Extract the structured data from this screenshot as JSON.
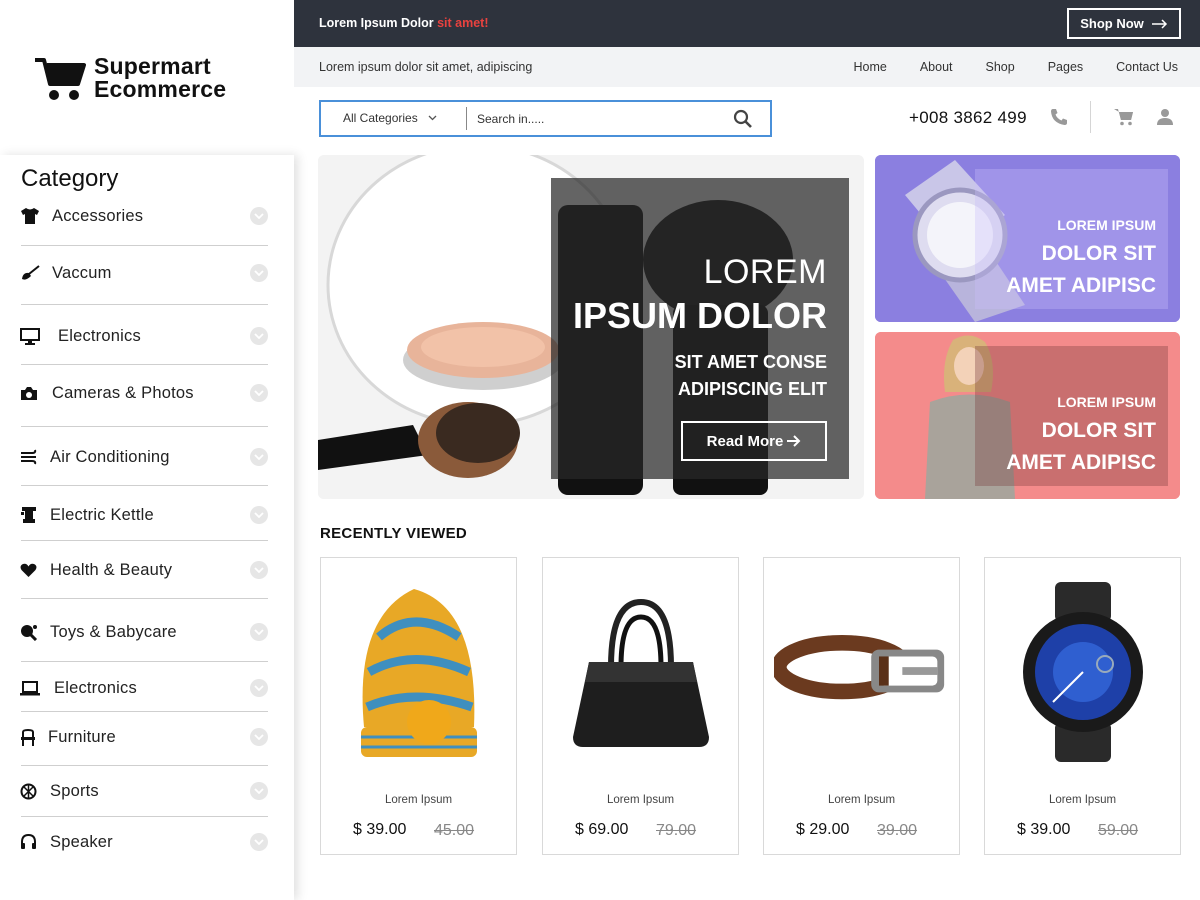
{
  "brand": {
    "line1": "Supermart",
    "line2": "Ecommerce"
  },
  "topbar": {
    "promo_text": "Lorem Ipsum Dolor",
    "promo_accent": "sit amet!",
    "shop_now": "Shop Now"
  },
  "navbar": {
    "tagline": "Lorem ipsum dolor sit amet, adipiscing",
    "links": [
      "Home",
      "About",
      "Shop",
      "Pages",
      "Contact Us"
    ]
  },
  "search": {
    "category": "All Categories",
    "placeholder": "Search in....."
  },
  "contact": {
    "phone": "+008 3862 499"
  },
  "sidebar": {
    "title": "Category",
    "items": [
      {
        "label": "Accessories",
        "icon": "tshirt-icon"
      },
      {
        "label": "Vaccum",
        "icon": "vacuum-icon"
      },
      {
        "label": "Electronics",
        "icon": "monitor-icon"
      },
      {
        "label": "Cameras & Photos",
        "icon": "camera-icon"
      },
      {
        "label": "Air Conditioning",
        "icon": "fan-icon"
      },
      {
        "label": "Electric Kettle",
        "icon": "kettle-icon"
      },
      {
        "label": "Health & Beauty",
        "icon": "heart-icon"
      },
      {
        "label": "Toys & Babycare",
        "icon": "toy-icon"
      },
      {
        "label": "Electronics",
        "icon": "laptop-icon"
      },
      {
        "label": "Furniture",
        "icon": "chair-icon"
      },
      {
        "label": "Sports",
        "icon": "ball-icon"
      },
      {
        "label": "Speaker",
        "icon": "headphones-icon"
      }
    ]
  },
  "hero": {
    "line1": "LOREM",
    "line2": "IPSUM DOLOR",
    "line3": "SIT AMET CONSE",
    "line4": "ADIPISCING ELIT",
    "button": "Read More"
  },
  "promos": [
    {
      "small": "LOREM IPSUM",
      "big1": "DOLOR SIT",
      "big2": "AMET ADIPISC"
    },
    {
      "small": "LOREM IPSUM",
      "big1": "DOLOR SIT",
      "big2": "AMET ADIPISC"
    }
  ],
  "recently_viewed": {
    "title": "RECENTLY VIEWED",
    "products": [
      {
        "name": "Lorem Ipsum",
        "price": "$ 39.00",
        "old_price": "45.00"
      },
      {
        "name": "Lorem Ipsum",
        "price": "$ 69.00",
        "old_price": "79.00"
      },
      {
        "name": "Lorem Ipsum",
        "price": "$ 29.00",
        "old_price": "39.00"
      },
      {
        "name": "Lorem Ipsum",
        "price": "$ 39.00",
        "old_price": "59.00"
      }
    ]
  },
  "colors": {
    "topbar": "#2e333d",
    "accent": "#e8423f",
    "search_border": "#4a90d9",
    "promo_purple": "#8b7fe0",
    "promo_pink": "#f48b8b"
  }
}
